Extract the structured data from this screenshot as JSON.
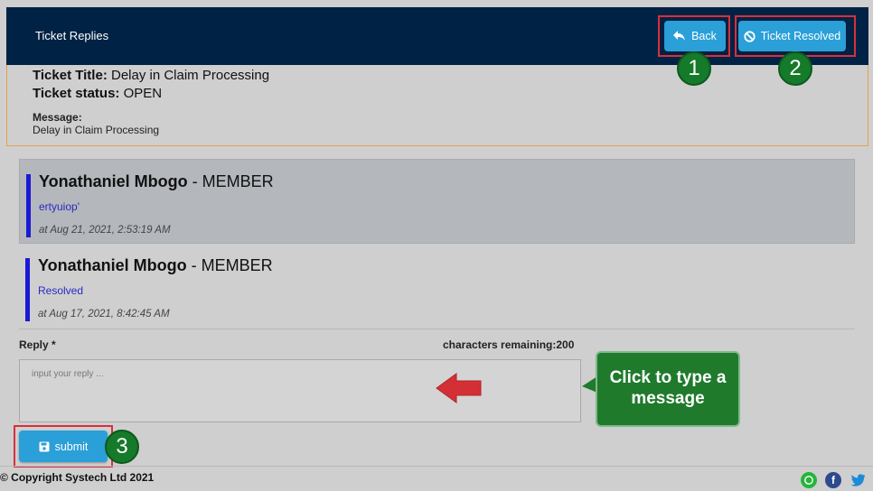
{
  "header": {
    "title": "Ticket Replies"
  },
  "buttons": {
    "back": "Back",
    "resolved": "Ticket Resolved",
    "submit": "submit"
  },
  "badges": [
    "1",
    "2",
    "3"
  ],
  "ticket": {
    "title_label": "Ticket Title:",
    "title_value": "Delay in Claim Processing",
    "status_label": "Ticket status:",
    "status_value": "OPEN",
    "message_label": "Message:",
    "message_value": "Delay in Claim Processing"
  },
  "replies": [
    {
      "name": "Yonathaniel Mbogo",
      "role": "- MEMBER",
      "text": "ertyuiop'",
      "date": "at Aug 21, 2021, 2:53:19 AM"
    },
    {
      "name": "Yonathaniel Mbogo",
      "role": "- MEMBER",
      "text": "Resolved",
      "date": "at Aug 17, 2021, 8:42:45 AM"
    }
  ],
  "form": {
    "reply_label": "Reply *",
    "chars_remaining": "characters remaining:200",
    "placeholder": "input your reply ..."
  },
  "callout": {
    "text": "Click to type a message"
  },
  "footer": {
    "copyright": "© Copyright Systech Ltd 2021"
  },
  "icons": {
    "back": "reply-arrow-icon",
    "resolved": "ban-icon",
    "submit": "save-icon",
    "social": [
      "whatsapp-icon",
      "facebook-icon",
      "twitter-icon"
    ]
  },
  "colors": {
    "header": "#002244",
    "button": "#2a9fd8",
    "highlight": "#d7303d",
    "badge": "#157a2a",
    "reply_bar": "#1a1ad6"
  }
}
